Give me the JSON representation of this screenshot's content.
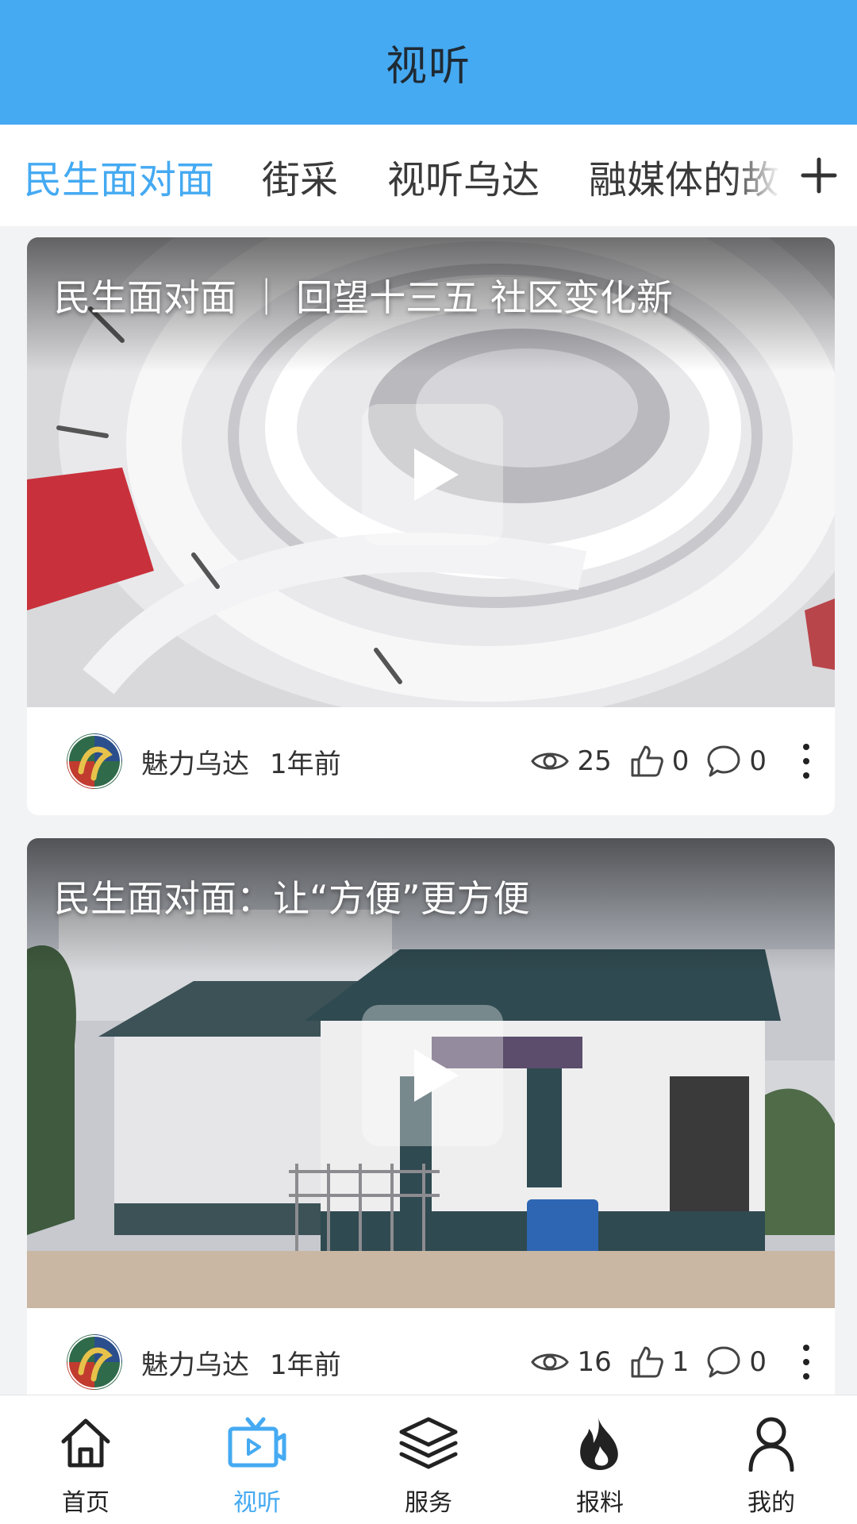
{
  "header": {
    "title": "视听"
  },
  "tabs": [
    {
      "label": "民生面对面",
      "active": true
    },
    {
      "label": "街采",
      "active": false
    },
    {
      "label": "视听乌达",
      "active": false
    },
    {
      "label": "融媒体的故",
      "active": false
    }
  ],
  "tabs_more_icon": "plus-icon",
  "cards": [
    {
      "title": "民生面对面 ｜ 回望十三五  社区变化新",
      "author": "魅力乌达",
      "time": "1年前",
      "views": "25",
      "likes": "0",
      "comments": "0"
    },
    {
      "title": "民生面对面：让“方便”更方便",
      "author": "魅力乌达",
      "time": "1年前",
      "views": "16",
      "likes": "1",
      "comments": "0"
    }
  ],
  "bottom_nav": [
    {
      "label": "首页",
      "icon": "home-icon",
      "active": false
    },
    {
      "label": "视听",
      "icon": "tv-icon",
      "active": true
    },
    {
      "label": "服务",
      "icon": "layers-icon",
      "active": false
    },
    {
      "label": "报料",
      "icon": "flame-icon",
      "active": false
    },
    {
      "label": "我的",
      "icon": "person-icon",
      "active": false
    }
  ],
  "colors": {
    "accent": "#45aaf2",
    "header_bg": "#45aaf2",
    "page_bg": "#f2f3f5"
  }
}
